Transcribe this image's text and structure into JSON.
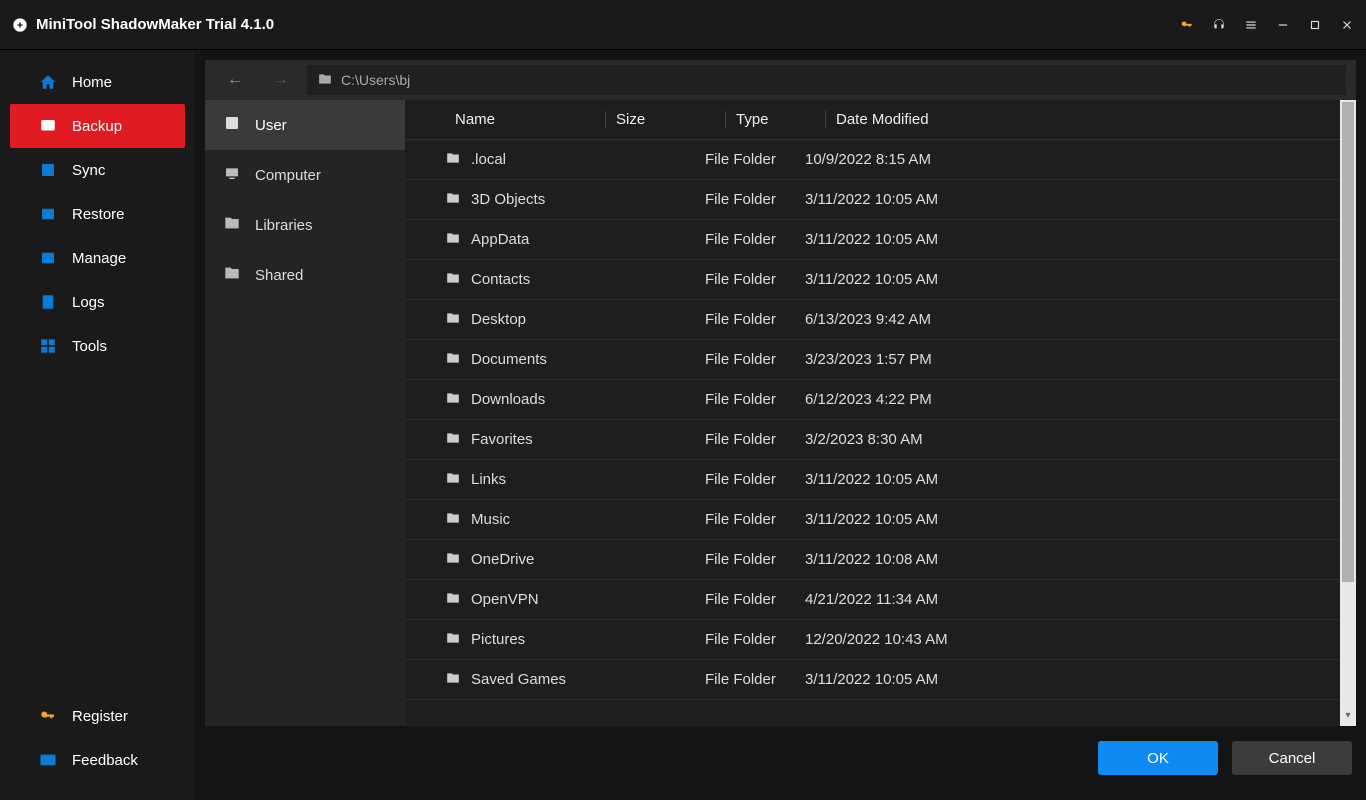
{
  "app": {
    "title": "MiniTool ShadowMaker Trial 4.1.0"
  },
  "sidebar": {
    "items": [
      {
        "label": "Home",
        "icon": "home",
        "active": false
      },
      {
        "label": "Backup",
        "icon": "backup",
        "active": true
      },
      {
        "label": "Sync",
        "icon": "sync",
        "active": false
      },
      {
        "label": "Restore",
        "icon": "restore",
        "active": false
      },
      {
        "label": "Manage",
        "icon": "manage",
        "active": false
      },
      {
        "label": "Logs",
        "icon": "logs",
        "active": false
      },
      {
        "label": "Tools",
        "icon": "tools",
        "active": false
      }
    ],
    "footer": [
      {
        "label": "Register",
        "icon": "key"
      },
      {
        "label": "Feedback",
        "icon": "mail"
      }
    ]
  },
  "browser": {
    "path": "C:\\Users\\bj",
    "sources": [
      {
        "label": "User",
        "active": true
      },
      {
        "label": "Computer",
        "active": false
      },
      {
        "label": "Libraries",
        "active": false
      },
      {
        "label": "Shared",
        "active": false
      }
    ],
    "columns": {
      "name": "Name",
      "size": "Size",
      "type": "Type",
      "date": "Date Modified"
    },
    "rows": [
      {
        "name": ".local",
        "type": "File Folder",
        "date": "10/9/2022 8:15 AM"
      },
      {
        "name": "3D Objects",
        "type": "File Folder",
        "date": "3/11/2022 10:05 AM"
      },
      {
        "name": "AppData",
        "type": "File Folder",
        "date": "3/11/2022 10:05 AM"
      },
      {
        "name": "Contacts",
        "type": "File Folder",
        "date": "3/11/2022 10:05 AM"
      },
      {
        "name": "Desktop",
        "type": "File Folder",
        "date": "6/13/2023 9:42 AM"
      },
      {
        "name": "Documents",
        "type": "File Folder",
        "date": "3/23/2023 1:57 PM"
      },
      {
        "name": "Downloads",
        "type": "File Folder",
        "date": "6/12/2023 4:22 PM"
      },
      {
        "name": "Favorites",
        "type": "File Folder",
        "date": "3/2/2023 8:30 AM"
      },
      {
        "name": "Links",
        "type": "File Folder",
        "date": "3/11/2022 10:05 AM"
      },
      {
        "name": "Music",
        "type": "File Folder",
        "date": "3/11/2022 10:05 AM"
      },
      {
        "name": "OneDrive",
        "type": "File Folder",
        "date": "3/11/2022 10:08 AM"
      },
      {
        "name": "OpenVPN",
        "type": "File Folder",
        "date": "4/21/2022 11:34 AM"
      },
      {
        "name": "Pictures",
        "type": "File Folder",
        "date": "12/20/2022 10:43 AM"
      },
      {
        "name": "Saved Games",
        "type": "File Folder",
        "date": "3/11/2022 10:05 AM"
      }
    ]
  },
  "actions": {
    "ok": "OK",
    "cancel": "Cancel"
  }
}
